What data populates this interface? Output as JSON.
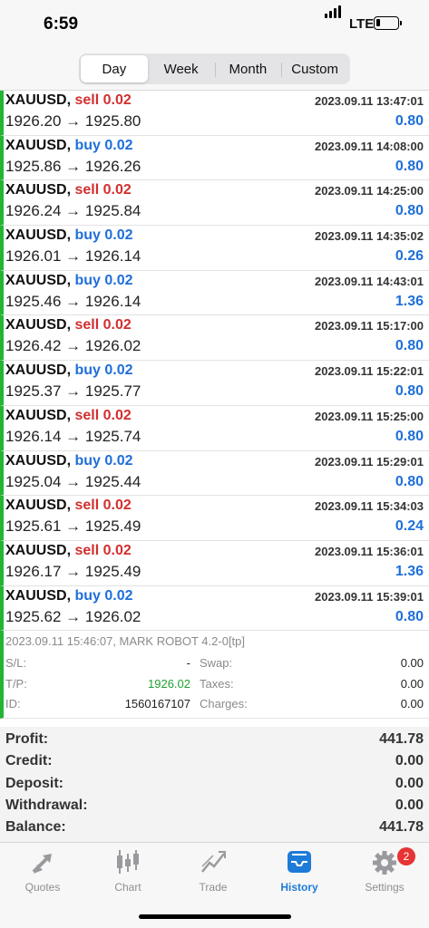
{
  "status": {
    "time": "6:59",
    "network": "LTE"
  },
  "tabs": [
    "Day",
    "Week",
    "Month",
    "Custom"
  ],
  "active_tab": "Day",
  "trades": [
    {
      "symbol": "XAUUSD,",
      "dir": "sell 0.02",
      "type": "sell",
      "prices": "1926.20 → 1925.80",
      "date": "2023.09.11 13:47:01",
      "profit": "0.80"
    },
    {
      "symbol": "XAUUSD,",
      "dir": "buy 0.02",
      "type": "buy",
      "prices": "1925.86 → 1926.26",
      "date": "2023.09.11 14:08:00",
      "profit": "0.80"
    },
    {
      "symbol": "XAUUSD,",
      "dir": "sell 0.02",
      "type": "sell",
      "prices": "1926.24 → 1925.84",
      "date": "2023.09.11 14:25:00",
      "profit": "0.80"
    },
    {
      "symbol": "XAUUSD,",
      "dir": "buy 0.02",
      "type": "buy",
      "prices": "1926.01 → 1926.14",
      "date": "2023.09.11 14:35:02",
      "profit": "0.26"
    },
    {
      "symbol": "XAUUSD,",
      "dir": "buy 0.02",
      "type": "buy",
      "prices": "1925.46 → 1926.14",
      "date": "2023.09.11 14:43:01",
      "profit": "1.36"
    },
    {
      "symbol": "XAUUSD,",
      "dir": "sell 0.02",
      "type": "sell",
      "prices": "1926.42 → 1926.02",
      "date": "2023.09.11 15:17:00",
      "profit": "0.80"
    },
    {
      "symbol": "XAUUSD,",
      "dir": "buy 0.02",
      "type": "buy",
      "prices": "1925.37 → 1925.77",
      "date": "2023.09.11 15:22:01",
      "profit": "0.80"
    },
    {
      "symbol": "XAUUSD,",
      "dir": "sell 0.02",
      "type": "sell",
      "prices": "1926.14 → 1925.74",
      "date": "2023.09.11 15:25:00",
      "profit": "0.80"
    },
    {
      "symbol": "XAUUSD,",
      "dir": "buy 0.02",
      "type": "buy",
      "prices": "1925.04 → 1925.44",
      "date": "2023.09.11 15:29:01",
      "profit": "0.80"
    },
    {
      "symbol": "XAUUSD,",
      "dir": "sell 0.02",
      "type": "sell",
      "prices": "1925.61 → 1925.49",
      "date": "2023.09.11 15:34:03",
      "profit": "0.24"
    },
    {
      "symbol": "XAUUSD,",
      "dir": "sell 0.02",
      "type": "sell",
      "prices": "1926.17 → 1925.49",
      "date": "2023.09.11 15:36:01",
      "profit": "1.36"
    },
    {
      "symbol": "XAUUSD,",
      "dir": "buy 0.02",
      "type": "buy",
      "prices": "1925.62 → 1926.02",
      "date": "2023.09.11 15:39:01",
      "profit": "0.80"
    }
  ],
  "details": {
    "meta": "2023.09.11 15:46:07, MARK ROBOT 4.2-0[tp]",
    "sl_label": "S/L:",
    "sl_value": "-",
    "tp_label": "T/P:",
    "tp_value": "1926.02",
    "id_label": "ID:",
    "id_value": "1560167107",
    "swap_label": "Swap:",
    "swap_value": "0.00",
    "taxes_label": "Taxes:",
    "taxes_value": "0.00",
    "charges_label": "Charges:",
    "charges_value": "0.00"
  },
  "summary": [
    {
      "label": "Profit:",
      "value": "441.78"
    },
    {
      "label": "Credit:",
      "value": "0.00"
    },
    {
      "label": "Deposit:",
      "value": "0.00"
    },
    {
      "label": "Withdrawal:",
      "value": "0.00"
    },
    {
      "label": "Balance:",
      "value": "441.78"
    }
  ],
  "tabbar": [
    {
      "label": "Quotes",
      "icon": "quotes-arrows-icon"
    },
    {
      "label": "Chart",
      "icon": "candlestick-chart-icon"
    },
    {
      "label": "Trade",
      "icon": "trade-line-icon"
    },
    {
      "label": "History",
      "icon": "inbox-tray-icon"
    },
    {
      "label": "Settings",
      "icon": "gear-icon",
      "badge": "2"
    }
  ],
  "active_bottom_tab": "History",
  "colors": {
    "sell": "#d22f2f",
    "buy": "#1e6fd9",
    "accent": "#1e7bd8",
    "profit_bar": "#21b532"
  }
}
